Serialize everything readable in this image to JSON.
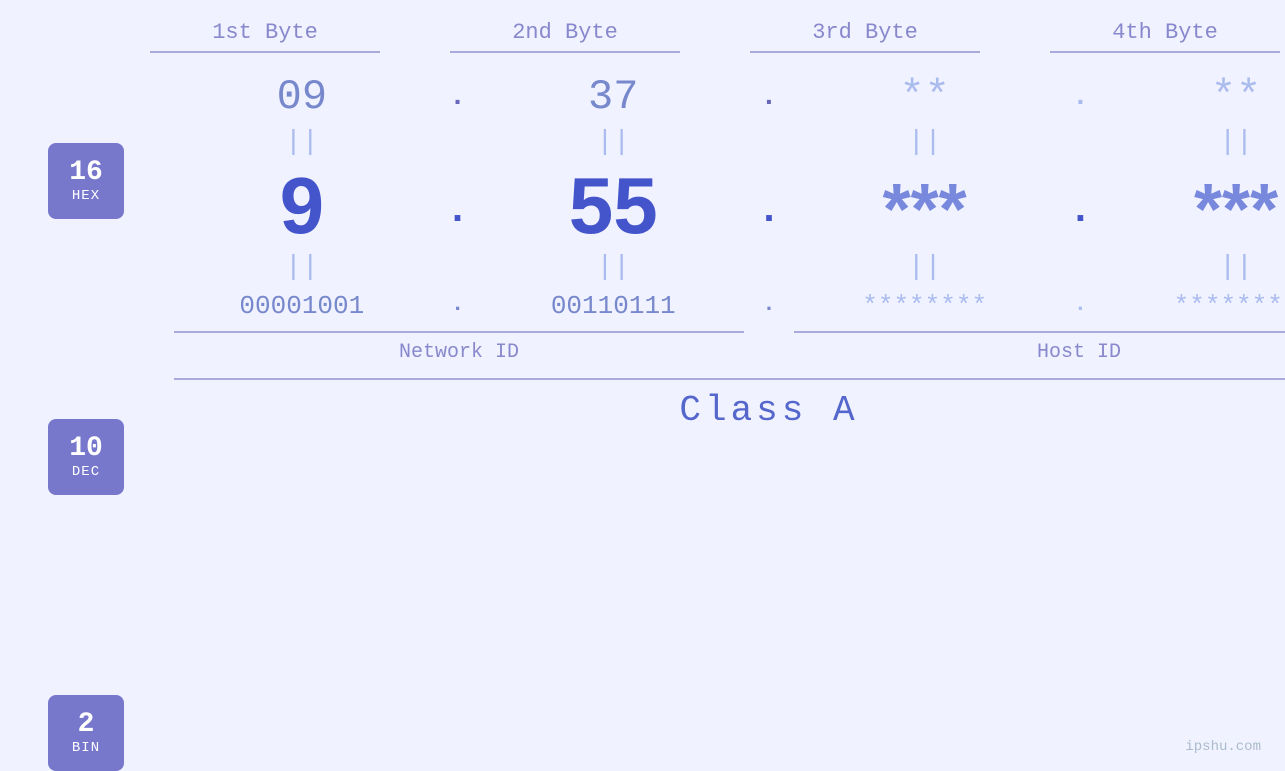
{
  "headers": {
    "byte1": "1st Byte",
    "byte2": "2nd Byte",
    "byte3": "3rd Byte",
    "byte4": "4th Byte"
  },
  "badges": {
    "hex": {
      "number": "16",
      "label": "HEX"
    },
    "dec": {
      "number": "10",
      "label": "DEC"
    },
    "bin": {
      "number": "2",
      "label": "BIN"
    }
  },
  "rows": {
    "hex": {
      "b1": "09",
      "b2": "37",
      "b3": "**",
      "b4": "**",
      "d1": ".",
      "d2": ".",
      "d3": ".",
      "d4": ""
    },
    "dec": {
      "b1": "9",
      "b2": "55",
      "b3": "***",
      "b4": "***",
      "d1": ".",
      "d2": ".",
      "d3": ".",
      "d4": ""
    },
    "bin": {
      "b1": "00001001",
      "b2": "00110111",
      "b3": "********",
      "b4": "********",
      "d1": ".",
      "d2": ".",
      "d3": ".",
      "d4": ""
    }
  },
  "labels": {
    "network_id": "Network ID",
    "host_id": "Host ID",
    "class": "Class A"
  },
  "watermark": "ipshu.com"
}
